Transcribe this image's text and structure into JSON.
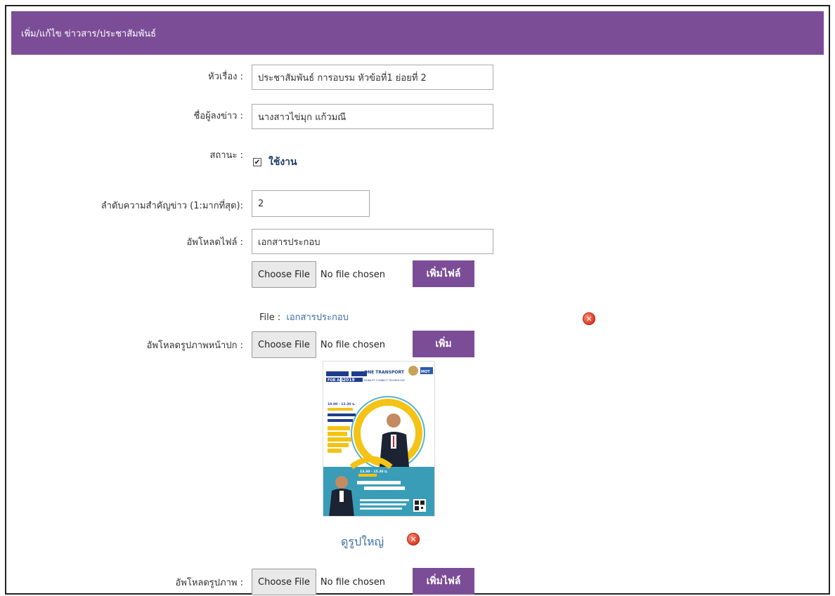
{
  "header": {
    "title": "เพิ่ม/แก้ไข ข่าวสาร/ประชาสัมพันธ์"
  },
  "form": {
    "title_label": "หัวเรื่อง :",
    "title_value": "ประชาสัมพันธ์ การอบรม หัวข้อที่1 ย่อยที่ 2",
    "author_label": "ชื่อผู้ลงข่าว :",
    "author_value": "นางสาวไข่มุก แก้วมณี",
    "status_label": "สถานะ :",
    "status_checkbox_label": "ใช้งาน",
    "status_checked": true,
    "priority_label": "ลำดับความสำคัญข่าว (1:มากที่สุด):",
    "priority_value": "2",
    "upload_file_label": "อัพโหลดไฟล์ :",
    "upload_file_name": "เอกสารประกอบ",
    "choose_file_label": "Choose File",
    "no_file_chosen": "No file chosen",
    "add_file_button": "เพิ่มไฟล์",
    "file_prefix": "File :",
    "file_link": "เอกสารประกอบ",
    "cover_label": "อัพโหลดรูปภาพหน้าปก :",
    "add_cover_button": "เพิ่ม",
    "view_large_link": "ดูรูปใหญ่",
    "image_label": "อัพโหลดรูปภาพ :",
    "add_image_button": "เพิ่มไฟล์"
  },
  "poster": {
    "top_text": "ONE TRANSPORT",
    "badge": "FOR ALL",
    "year": "2019",
    "subtitle": "MOBILITY CONNECT TECHNOLOGY",
    "mot": "MOT",
    "time1": "10.00 - 12.30 น.",
    "time2": "13.30 - 15.30 น."
  },
  "colors": {
    "accent": "#7c4d97",
    "link": "#3b6ea8",
    "delete": "#d8341f"
  }
}
